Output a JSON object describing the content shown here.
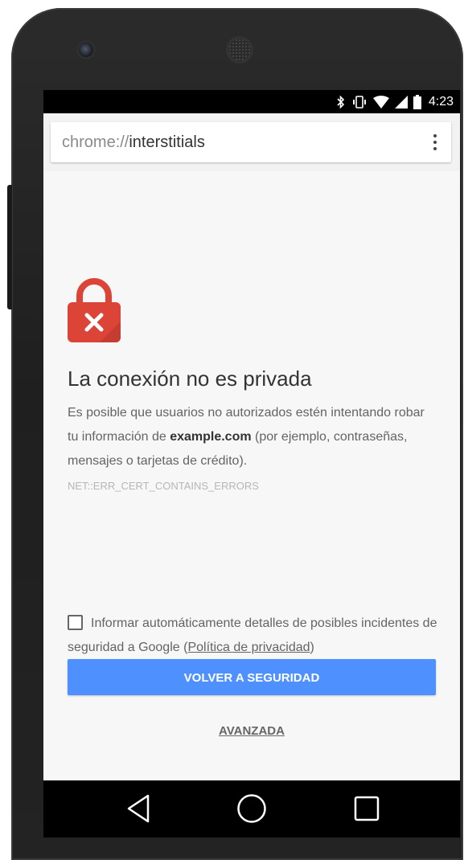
{
  "status_bar": {
    "time": "4:23",
    "icons": [
      "bluetooth-icon",
      "vibrate-icon",
      "wifi-icon",
      "cellular-signal-icon",
      "battery-icon"
    ]
  },
  "chrome": {
    "url_scheme": "chrome://",
    "url_host": "interstitials",
    "menu_icon": "more-vert-icon"
  },
  "interstitial": {
    "icon": "lock-error-icon",
    "heading": "La conexión no es privada",
    "message_before": "Es posible que usuarios no autorizados estén intentando robar tu información de ",
    "message_domain": "example.com",
    "message_after": " (por ejemplo, contraseñas, mensajes o tarjetas de crédito).",
    "error_code": "NET::ERR_CERT_CONTAINS_ERRORS",
    "checkbox_label": "Informar automáticamente detalles de posibles incidentes de seguridad a Google (",
    "privacy_link": "Política de privacidad",
    "checkbox_label_end": ")",
    "checkbox_checked": false,
    "primary_button": "VOLVER A SEGURIDAD",
    "advanced_link": "AVANZADA"
  },
  "nav_bar": {
    "buttons": [
      "back-icon",
      "home-icon",
      "recents-icon"
    ]
  },
  "colors": {
    "primary_button": "#4d90fe",
    "lock_icon": "#db4437"
  }
}
